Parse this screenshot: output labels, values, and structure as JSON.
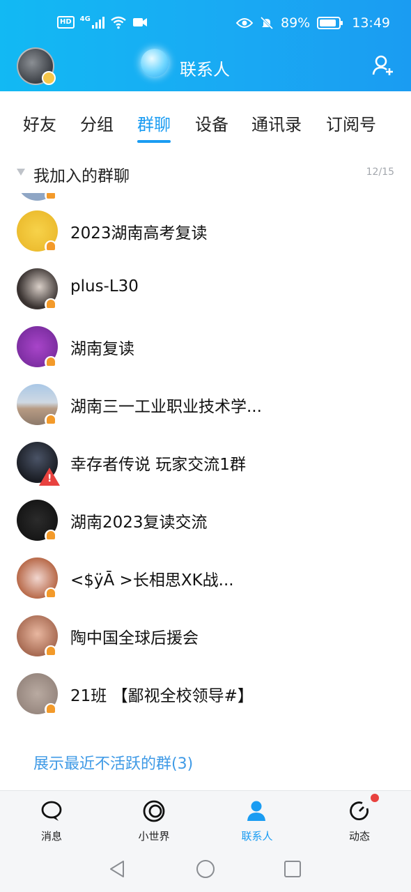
{
  "status_bar": {
    "left": [
      "HD",
      "4G"
    ],
    "battery": "89%",
    "battery_level": 0.89,
    "time": "13:49"
  },
  "header": {
    "title": "联系人"
  },
  "tabs": [
    "好友",
    "分组",
    "群聊",
    "设备",
    "通讯录",
    "订阅号"
  ],
  "active_tab": "群聊",
  "section": {
    "title": "我加入的群聊",
    "count": "12/15"
  },
  "groups": [
    {
      "name": "2023湖南高考复读",
      "status": "muted"
    },
    {
      "name": "plus-L30",
      "status": "muted"
    },
    {
      "name": "湖南复读",
      "status": "muted"
    },
    {
      "name": "湖南三一工业职业技术学...",
      "status": "muted"
    },
    {
      "name": "幸存者传说 玩家交流1群",
      "status": "warning"
    },
    {
      "name": "湖南2023复读交流",
      "status": "muted"
    },
    {
      "name": "<$ÿĀ        >长相思XK战...",
      "status": "muted"
    },
    {
      "name": "陶中国全球后援会",
      "status": "muted"
    },
    {
      "name": "21班 【鄙视全校领导#】",
      "status": "muted"
    }
  ],
  "show_inactive": "展示最近不活跃的群(3)",
  "bottom_nav": [
    {
      "label": "消息",
      "icon": "message-icon"
    },
    {
      "label": "小世界",
      "icon": "world-icon"
    },
    {
      "label": "联系人",
      "icon": "contacts-icon",
      "active": true
    },
    {
      "label": "动态",
      "icon": "moments-icon",
      "badge": true
    }
  ],
  "colors": {
    "accent": "#1a9cf2",
    "mute_bell": "#f39a2a",
    "warning": "#e8423f"
  }
}
